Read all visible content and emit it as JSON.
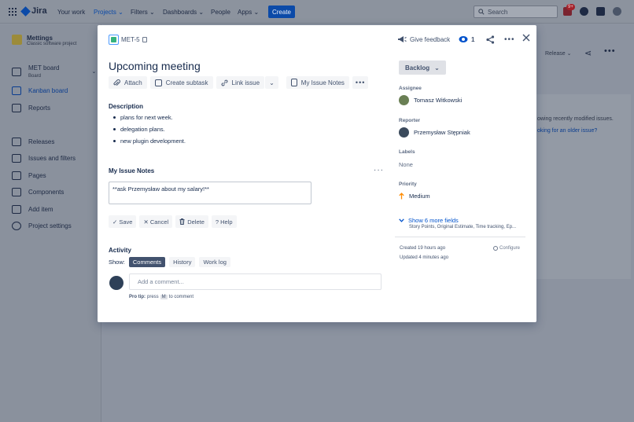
{
  "nav": {
    "logo": "Jira",
    "items": [
      "Your work",
      "Projects ⌄",
      "Filters ⌄",
      "Dashboards ⌄",
      "People",
      "Apps ⌄"
    ],
    "create": "Create",
    "search_placeholder": "Search",
    "notif_badge": "9+"
  },
  "sidebar": {
    "project_name": "Mettings",
    "project_type": "Classic software project",
    "board_name": "MET board",
    "board_sub": "Board",
    "items": [
      "Kanban board",
      "Reports",
      "Releases",
      "Issues and filters",
      "Pages",
      "Components",
      "Add item",
      "Project settings"
    ]
  },
  "background": {
    "release": "Release ⌄",
    "text1": "owing recently modified issues.",
    "text2": "oking for an older issue?"
  },
  "modal": {
    "issue_key": "MET-5",
    "give_feedback": "Give feedback",
    "watch_count": "1",
    "title": "Upcoming meeting",
    "toolbar": {
      "attach": "Attach",
      "create_subtask": "Create subtask",
      "link_issue": "Link issue",
      "my_issue_notes": "My Issue Notes"
    },
    "description_heading": "Description",
    "description_items": [
      "plans for next week.",
      "delegation plans.",
      "new plugin development."
    ],
    "notes_heading": "My Issue Notes",
    "notes_text": "**ask Przemysław about my salary!**",
    "note_actions": {
      "save": "✓ Save",
      "cancel": "✕ Cancel",
      "delete": "Delete",
      "help": "? Help"
    },
    "activity_heading": "Activity",
    "show_label": "Show:",
    "activity_tabs": [
      "Comments",
      "History",
      "Work log"
    ],
    "comment_placeholder": "Add a comment...",
    "protip_bold": "Pro tip:",
    "protip_pre": "press",
    "protip_key": "M",
    "protip_post": "to comment",
    "status": "Backlog",
    "assignee_label": "Assignee",
    "assignee": "Tomasz Witkowski",
    "reporter_label": "Reporter",
    "reporter": "Przemysław Stępniak",
    "labels_label": "Labels",
    "labels_value": "None",
    "priority_label": "Priority",
    "priority": "Medium",
    "show_more": "Show 6 more fields",
    "show_more_sub": "Story Points, Original Estimate, Time tracking, Ep...",
    "created": "Created 19 hours ago",
    "updated": "Updated 4 minutes ago",
    "configure": "Configure"
  },
  "colors": {
    "accent": "#0052cc",
    "priority_medium": "#ff8b00",
    "story": "#36b37e"
  }
}
